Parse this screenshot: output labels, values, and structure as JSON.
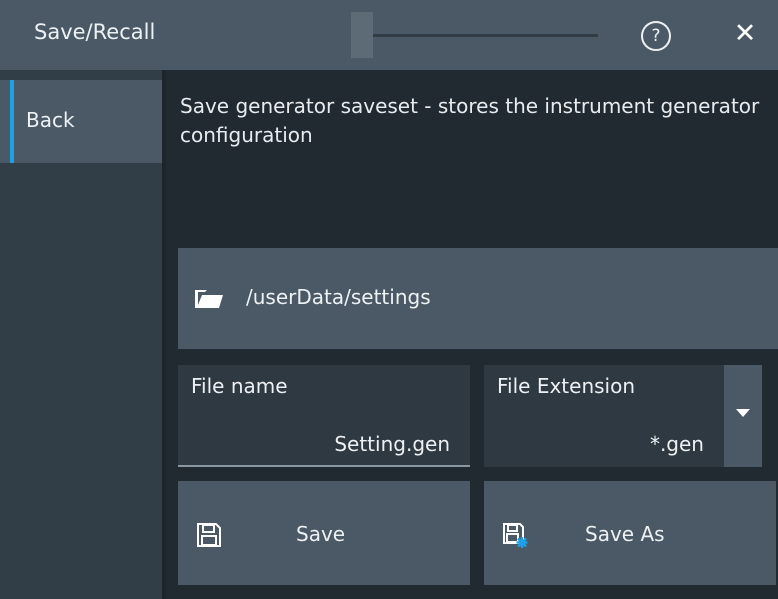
{
  "titlebar": {
    "title": "Save/Recall",
    "help_label": "?",
    "close_label": "✕"
  },
  "sidebar": {
    "back_label": "Back"
  },
  "main": {
    "description": "Save generator saveset - stores the instrument generator configuration",
    "path": "/userData/settings",
    "file_name_label": "File name",
    "file_name_value": "Setting.gen",
    "file_extension_label": "File Extension",
    "file_extension_value": "*.gen",
    "save_label": "Save",
    "save_as_label": "Save As"
  },
  "colors": {
    "accent": "#1ea0e6",
    "panel": "#4a5965",
    "background": "#212a31"
  },
  "icons": [
    "folder-open-icon",
    "floppy-disk-icon",
    "floppy-disk-new-icon",
    "help-icon",
    "close-icon",
    "dropdown-arrow-icon"
  ]
}
